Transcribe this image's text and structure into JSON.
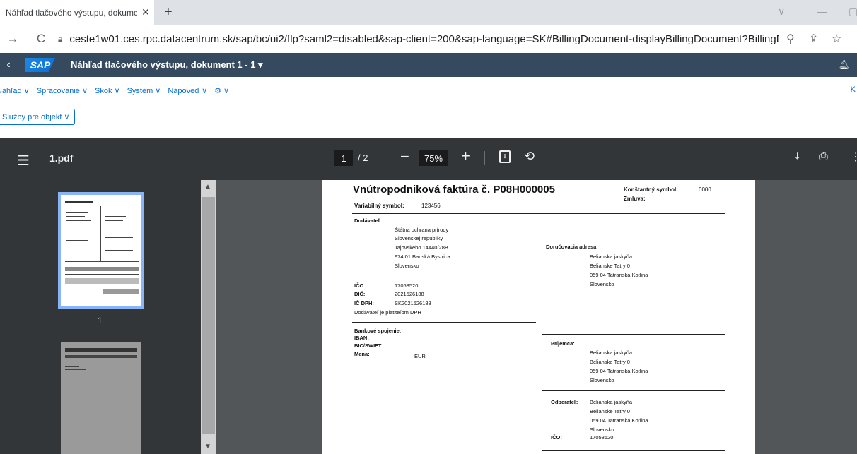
{
  "browser": {
    "tab_title": "Náhľad tlačového výstupu, dokume",
    "tab_close": "✕",
    "new_tab": "+",
    "url": "ceste1w01.ces.rpc.datacentrum.sk/sap/bc/ui2/flp?saml2=disabled&sap-client=200&sap-language=SK#BillingDocument-displayBillingDocument?BillingD..."
  },
  "sap": {
    "logo": "SAP",
    "title": "Náhľad tlačového výstupu, dokument 1 - 1 ▾",
    "menu": [
      "Náhľad ∨",
      "Spracovanie ∨",
      "Skok ∨",
      "Systém ∨",
      "Nápoveď ∨",
      "⚙ ∨"
    ],
    "menu_right": "K",
    "services_button": "Služby pre objekt ∨"
  },
  "pdf": {
    "file_name": "1.pdf",
    "current_page": "1",
    "total_pages": "/ 2",
    "zoom": "75%",
    "thumbnail_label": "1"
  },
  "invoice": {
    "title": "Vnútropodniková faktúra č. P08H000005",
    "konstantny_label": "Konštantný symbol:",
    "konstantny_value": "0000",
    "zmluva_label": "Zmluva:",
    "variabilny_label": "Variabilný symbol:",
    "variabilny_value": "123456",
    "dodavatel_label": "Dodávateľ:",
    "dodavatel_lines": [
      "Štátna ochrana prírody",
      "Slovenskej republiky",
      "Tajovského 14440/28B",
      "974 01  Banská Bystrica",
      "Slovensko"
    ],
    "ico_label": "IČO:",
    "ico_value": "17058520",
    "dic_label": "DIČ:",
    "dic_value": "2021526188",
    "icdph_label": "IČ DPH:",
    "icdph_value": "SK2021526188",
    "platitel": "Dodávateľ je platiteľom DPH",
    "bank_label": "Bankové spojenie:",
    "iban_label": "IBAN:",
    "bic_label": "BIC/SWIFT:",
    "mena_label": "Mena:",
    "mena_value": "EUR",
    "dorucovacia_label": "Doručovacia adresa:",
    "dorucovacia_lines": [
      "Belianska jaskyňa",
      "Belianske Tatry 0",
      "059 04 Tatranská Kotlina",
      "Slovensko"
    ],
    "prijemca_label": "Príjemca:",
    "prijemca_lines": [
      "Belianska jaskyňa",
      "Belianske Tatry 0",
      "059 04 Tatranská Kotlina",
      "Slovensko"
    ],
    "odberatel_label": "Odberateľ:",
    "odberatel_lines": [
      "Belianska jaskyňa",
      "Belianske Tatry 0",
      "059 04 Tatranská Kotlina",
      "Slovensko"
    ],
    "odb_ico_label": "IČO:",
    "odb_ico_value": "17058520"
  }
}
